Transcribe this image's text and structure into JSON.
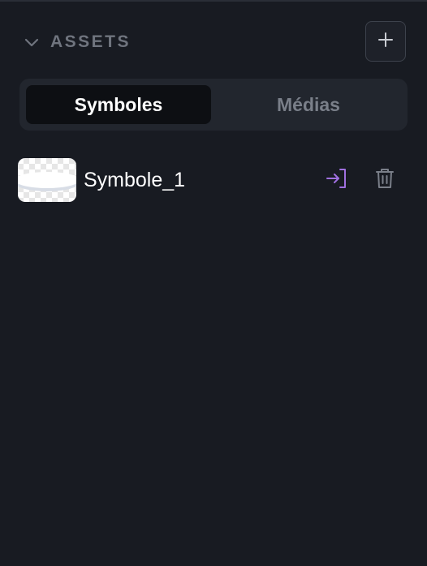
{
  "assets_panel": {
    "title": "ASSETS",
    "collapse_icon": "chevron-down-icon",
    "add_icon": "plus-icon"
  },
  "tabs": [
    {
      "label": "Symboles",
      "active": true
    },
    {
      "label": "Médias",
      "active": false
    }
  ],
  "assets": [
    {
      "name": "Symbole_1",
      "thumbnail": "ellipse-shape-on-transparent",
      "actions": [
        "enter-symbol-icon",
        "trash-icon"
      ]
    }
  ],
  "colors": {
    "background": "#181b22",
    "tabs_background": "#22262e",
    "active_tab": "#0d0f13",
    "title_text": "#6f747e",
    "accent": "#a070e0",
    "icon_muted": "#7a7f89"
  }
}
